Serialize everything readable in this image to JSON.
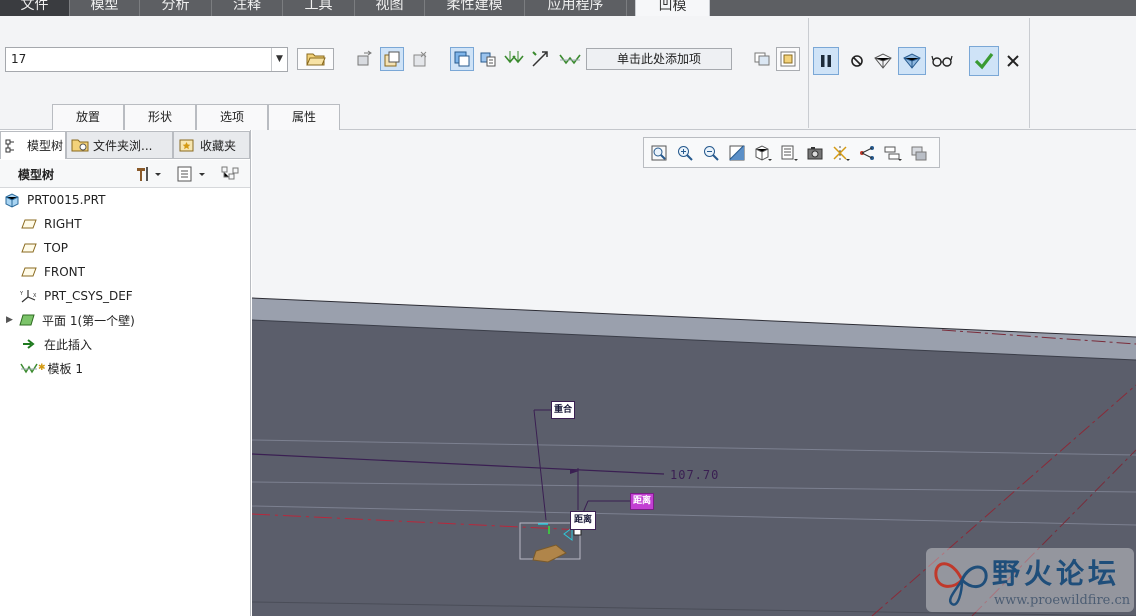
{
  "ribbon": {
    "tabs": [
      {
        "label": "文件"
      },
      {
        "label": "模型"
      },
      {
        "label": "分析"
      },
      {
        "label": "注释"
      },
      {
        "label": "工具"
      },
      {
        "label": "视图"
      },
      {
        "label": "柔性建模"
      },
      {
        "label": "应用程序"
      },
      {
        "label": "凹模"
      }
    ],
    "active_tab": "凹模"
  },
  "dashboard": {
    "reference_value": "17",
    "add_item_label": "单击此处添加项",
    "sub_tabs": [
      "放置",
      "形状",
      "选项",
      "属性"
    ]
  },
  "navigator": {
    "tabs": [
      "模型树",
      "文件夹浏...",
      "收藏夹"
    ],
    "title": "模型树",
    "tree": [
      {
        "label": "PRT0015.PRT",
        "icon": "part-icon"
      },
      {
        "label": "RIGHT",
        "icon": "datum-plane-icon"
      },
      {
        "label": "TOP",
        "icon": "datum-plane-icon"
      },
      {
        "label": "FRONT",
        "icon": "datum-plane-icon"
      },
      {
        "label": "PRT_CSYS_DEF",
        "icon": "csys-icon"
      },
      {
        "label": "平面 1(第一个壁)",
        "icon": "sheetmetal-wall-icon"
      },
      {
        "label": "在此插入",
        "icon": "insert-here-arrow-icon"
      },
      {
        "label": "模板 1",
        "icon": "die-form-icon"
      }
    ]
  },
  "viewport": {
    "dimension_value": "107.70",
    "tag_coincident": "重合",
    "tag_distance": "距离",
    "tag_distance_active": "距离"
  },
  "watermark": {
    "title": "野火论坛",
    "url": "www.proewildfire.cn"
  },
  "colors": {
    "model_face_dark": "#5b5e6b",
    "model_face_light": "#9aa0ad",
    "dimension_line": "#3a1f52",
    "datum_red": "#b8283c",
    "accent_blue": "#1f4e7a",
    "tag_magenta": "#c23fd2",
    "ok_green": "#3a9a32"
  }
}
